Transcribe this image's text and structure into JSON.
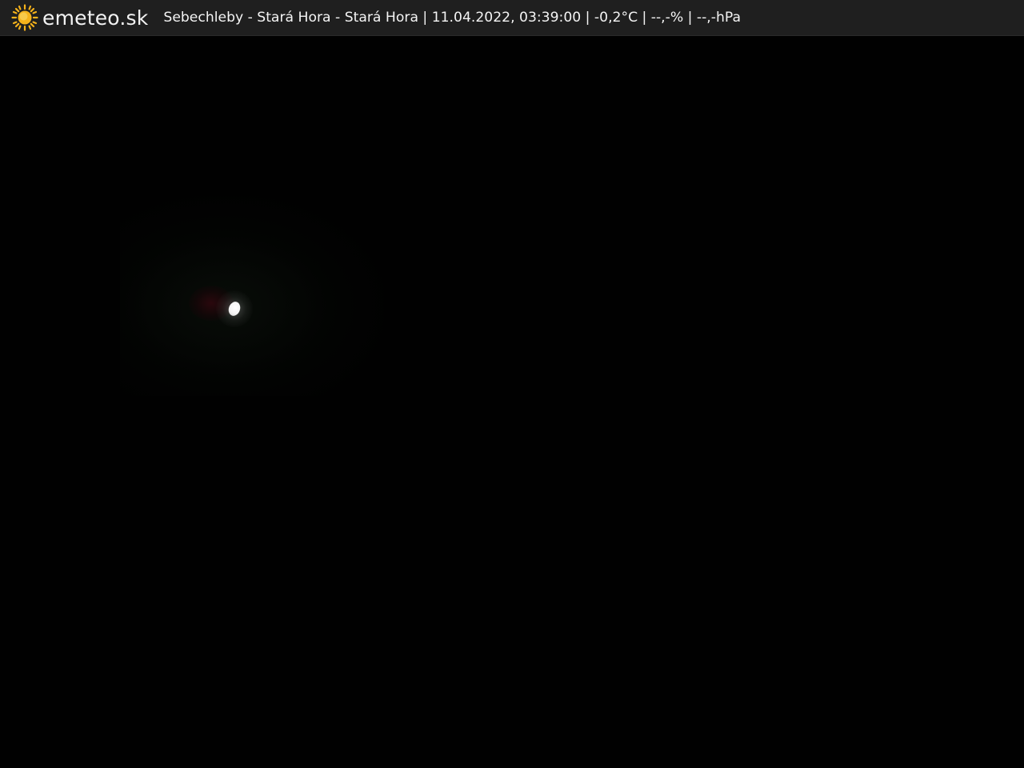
{
  "header": {
    "logo_text": "emeteo.sk",
    "logo_icon": "sun-icon",
    "station_info": "Sebechleby - Stará Hora - Stará Hora | 11.04.2022, 03:39:00 | -0,2°C | --,-% | --,-hPa"
  },
  "colors": {
    "bar_background": "#1f1f1f",
    "sun_color": "#f5b21b",
    "text_color": "#f4f4f4",
    "scene_background": "#010101"
  }
}
